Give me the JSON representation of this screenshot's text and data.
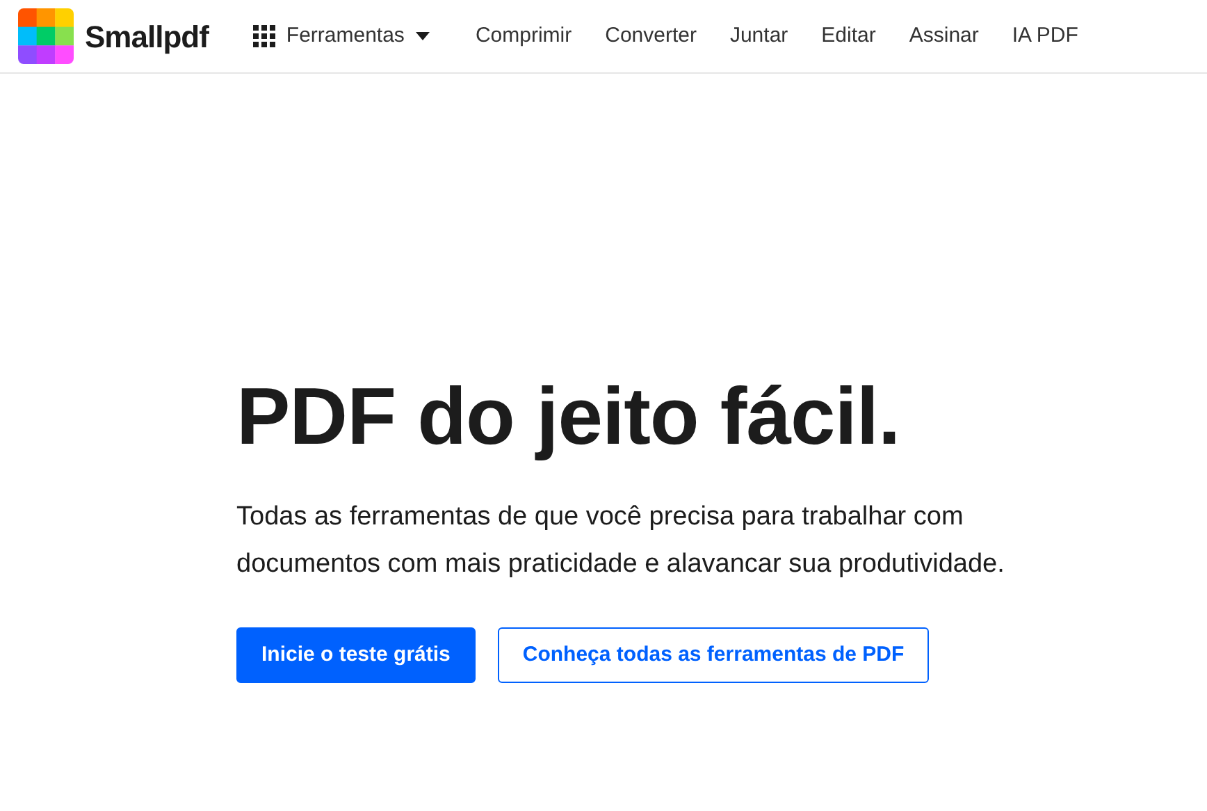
{
  "header": {
    "logo_text": "Smallpdf",
    "tools_menu": {
      "label": "Ferramentas",
      "expanded": false
    },
    "nav": [
      "Comprimir",
      "Converter",
      "Juntar",
      "Editar",
      "Assinar",
      "IA PDF"
    ]
  },
  "hero": {
    "title": "PDF do jeito fácil.",
    "subtitle": "Todas as ferramentas de que você precisa para trabalhar com documentos com mais praticidade e alavancar sua produtividade.",
    "buttons": [
      {
        "label": "Inicie o teste grátis",
        "kind": "primary"
      },
      {
        "label": "Conheça todas as ferramentas de PDF",
        "kind": "secondary"
      }
    ]
  }
}
